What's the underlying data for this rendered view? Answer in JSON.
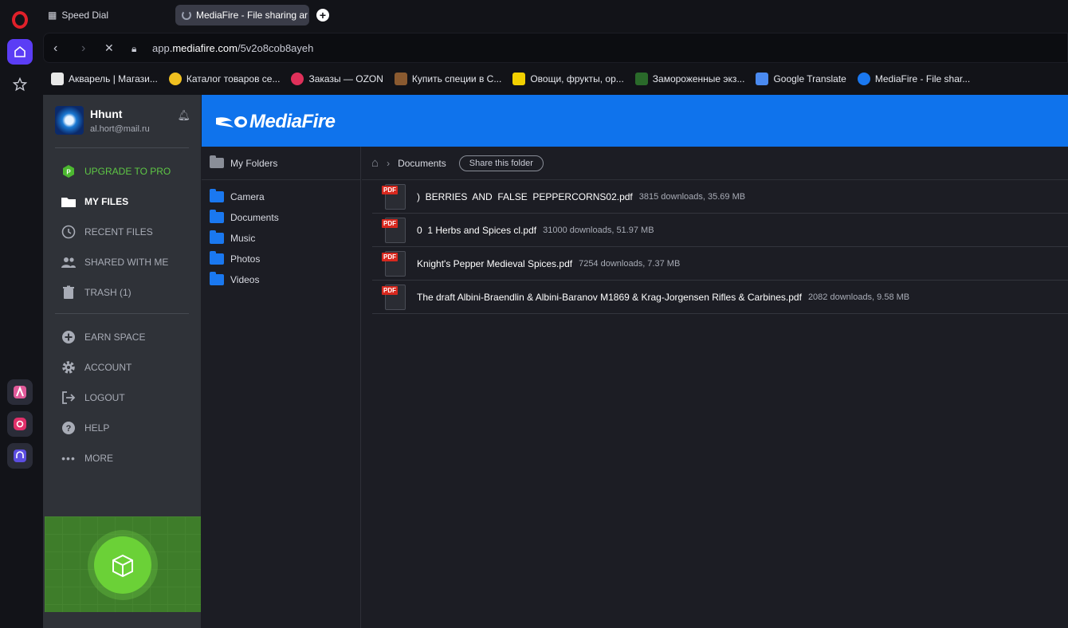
{
  "browser": {
    "tabs": [
      {
        "label": "Speed Dial"
      },
      {
        "label": "MediaFire - File sharing ar"
      }
    ],
    "url_prefix": "app.",
    "url_domain": "mediafire.com",
    "url_path": "/5v2o8cob8ayeh",
    "bookmarks": [
      {
        "label": "Акварель | Магази...",
        "color": "#e8e8e8"
      },
      {
        "label": "Каталог товаров се...",
        "color": "#f0c020"
      },
      {
        "label": "Заказы — OZON",
        "color": "#e0305a"
      },
      {
        "label": "Купить специи в С...",
        "color": "#8a5a30"
      },
      {
        "label": "Овощи, фрукты, ор...",
        "color": "#f2d000"
      },
      {
        "label": "Замороженные экз...",
        "color": "#2a6a2a"
      },
      {
        "label": "Google Translate",
        "color": "#4a8af0"
      },
      {
        "label": "MediaFire - File shar...",
        "color": "#1a78f0"
      }
    ]
  },
  "user": {
    "name": "Hhunt",
    "email": "al.hort@mail.ru"
  },
  "nav": {
    "upgrade": "UPGRADE TO PRO",
    "my_files": "MY FILES",
    "recent_files": "RECENT FILES",
    "shared_with_me": "SHARED WITH ME",
    "trash": "TRASH (1)",
    "earn_space": "EARN SPACE",
    "account": "ACCOUNT",
    "logout": "LOGOUT",
    "help": "HELP",
    "more": "MORE"
  },
  "brand": {
    "logo_text": "MediaFire",
    "color": "#0f73ec"
  },
  "folders": {
    "heading": "My Folders",
    "items": [
      "Camera",
      "Documents",
      "Music",
      "Photos",
      "Videos"
    ]
  },
  "breadcrumb": {
    "current": "Documents",
    "share_label": "Share this folder"
  },
  "files": [
    {
      "name": ")  BERRIES  AND  FALSE  PEPPERCORNS02.pdf",
      "meta": "3815 downloads, 35.69 MB"
    },
    {
      "name": "0  1 Herbs and Spices cl.pdf",
      "meta": "31000 downloads, 51.97 MB"
    },
    {
      "name": "Knight's Pepper Medieval Spices.pdf",
      "meta": "7254 downloads, 7.37 MB"
    },
    {
      "name": "The draft Albini-Braendlin & Albini-Baranov M1869 & Krag-Jorgensen Rifles & Carbines.pdf",
      "meta": "2082 downloads, 9.58 MB"
    }
  ],
  "icons": {
    "pdf_tag": "PDF"
  }
}
